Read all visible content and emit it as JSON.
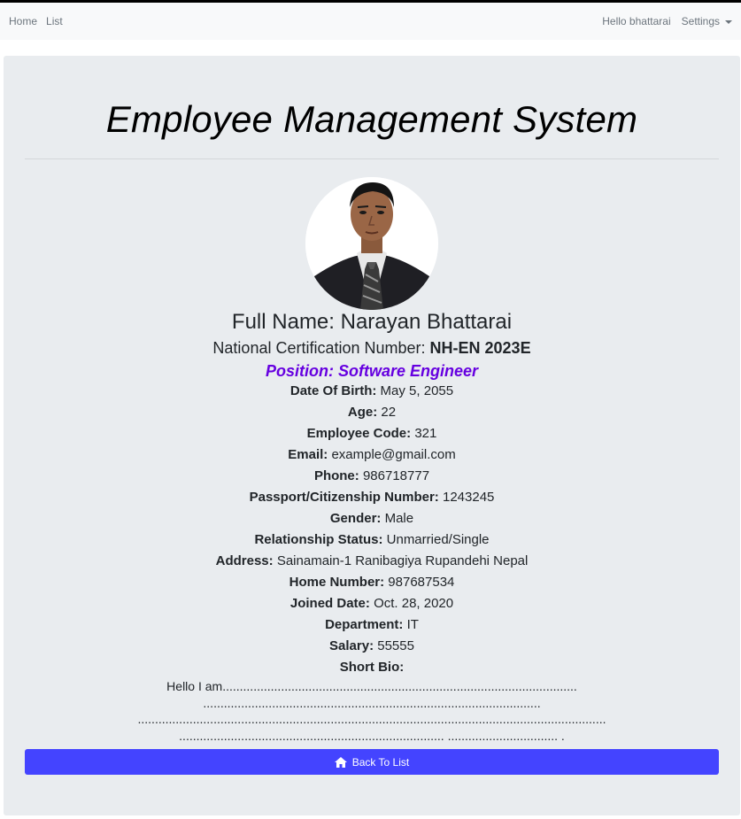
{
  "nav": {
    "home": "Home",
    "list": "List",
    "greeting": "Hello bhattarai",
    "settings": "Settings"
  },
  "page": {
    "title": "Employee Management System"
  },
  "profile": {
    "full_name": "Full Name: Narayan Bhattarai",
    "cert_label": "National Certification Number: ",
    "cert_value": "NH-EN 2023E",
    "position": "Position: Software Engineer",
    "details": [
      {
        "label": "Date Of Birth:",
        "value": "May 5, 2055"
      },
      {
        "label": "Age:",
        "value": "22"
      },
      {
        "label": "Employee Code:",
        "value": "321"
      },
      {
        "label": "Email:",
        "value": "example@gmail.com"
      },
      {
        "label": "Phone:",
        "value": "986718777"
      },
      {
        "label": "Passport/Citizenship Number:",
        "value": "1243245"
      },
      {
        "label": "Gender:",
        "value": "Male"
      },
      {
        "label": "Relationship Status:",
        "value": "Unmarried/Single"
      },
      {
        "label": "Address:",
        "value": "Sainamain-1 Ranibagiya Rupandehi Nepal"
      },
      {
        "label": "Home Number:",
        "value": "987687534"
      },
      {
        "label": "Joined Date:",
        "value": "Oct. 28, 2020"
      },
      {
        "label": "Department:",
        "value": "IT"
      },
      {
        "label": "Salary:",
        "value": "55555"
      },
      {
        "label": "Short Bio:",
        "value": ""
      }
    ],
    "bio_lines": [
      "Hello I am.......................................................................................................",
      "..................................................................................................",
      "........................................................................................................................................",
      "............................................................................. ................................ ."
    ]
  },
  "actions": {
    "back_label": "Back To List"
  },
  "colors": {
    "position": "#6600e0",
    "button": "#4444ff",
    "panel": "#e9ecef"
  },
  "icons": {
    "back": "home-icon",
    "settings": "chevron-down-icon"
  }
}
